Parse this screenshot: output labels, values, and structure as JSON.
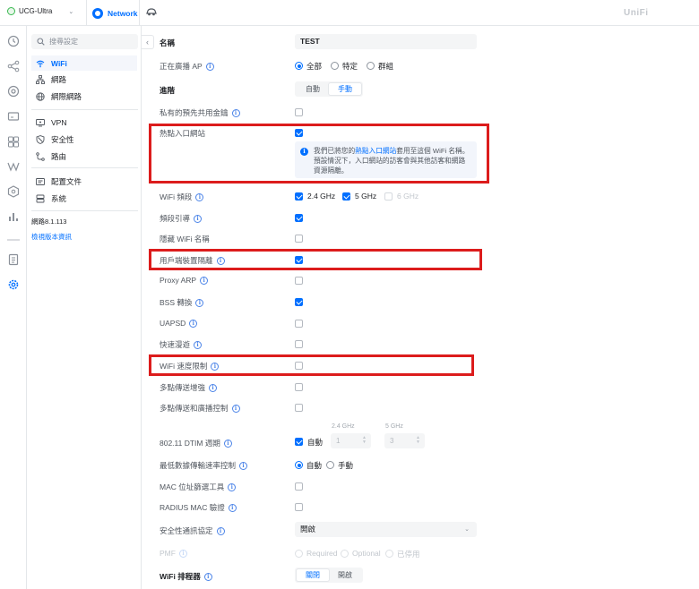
{
  "topbar": {
    "site_name": "UCG-Ultra",
    "app_tab": "Network",
    "brand": "UniFi"
  },
  "sidebar": {
    "search_placeholder": "搜尋設定",
    "items": [
      {
        "label": "WiFi",
        "icon": "wifi-icon"
      },
      {
        "label": "網路",
        "icon": "network-tree-icon"
      },
      {
        "label": "網際網路",
        "icon": "globe-icon"
      },
      {
        "label": "VPN",
        "icon": "vpn-icon"
      },
      {
        "label": "安全性",
        "icon": "shield-icon"
      },
      {
        "label": "路由",
        "icon": "route-icon"
      },
      {
        "label": "配置文件",
        "icon": "profile-icon"
      },
      {
        "label": "系統",
        "icon": "system-icon"
      }
    ],
    "version": "網路8.1.113",
    "release_notes": "檢視版本資訊"
  },
  "form": {
    "name": {
      "label": "名稱",
      "value": "TEST"
    },
    "broadcast_ap": {
      "label": "正在廣播 AP",
      "options": [
        "全部",
        "特定",
        "群組"
      ],
      "selected": 0
    },
    "advanced": {
      "label": "進階",
      "options": [
        "自動",
        "手動"
      ],
      "selected": 1
    },
    "private_psk": {
      "label": "私有的預先共用金鑰",
      "checked": false
    },
    "hotspot": {
      "label": "熱點入口網站",
      "checked": true
    },
    "notice": {
      "before": "我們已將您的",
      "link": "熱點入口網站",
      "after": "套用至這個 WiFi 名稱。預設情況下，入口網站的訪客會與其他訪客和網路資源隔離。"
    },
    "wifi_band": {
      "label": "WiFi 頻段",
      "bands": [
        {
          "name": "2.4 GHz",
          "checked": true,
          "disabled": false
        },
        {
          "name": "5 GHz",
          "checked": true,
          "disabled": false
        },
        {
          "name": "6 GHz",
          "checked": false,
          "disabled": true
        }
      ]
    },
    "band_steering": {
      "label": "頻段引導",
      "checked": true
    },
    "hide_ssid": {
      "label": "隱藏 WiFi 名稱",
      "checked": false
    },
    "client_isolation": {
      "label": "用戶端裝置隔離",
      "checked": true
    },
    "proxy_arp": {
      "label": "Proxy ARP",
      "checked": false
    },
    "bss_transition": {
      "label": "BSS 轉換",
      "checked": true
    },
    "uapsd": {
      "label": "UAPSD",
      "checked": false
    },
    "fast_roaming": {
      "label": "快速漫遊",
      "checked": false
    },
    "wifi_rate_limit": {
      "label": "WiFi 速度限制",
      "checked": false
    },
    "multicast_enhance": {
      "label": "多點傳送增強",
      "checked": false
    },
    "multicast_broadcast": {
      "label": "多點傳送和廣播控制",
      "checked": false
    },
    "dtim": {
      "label": "802.11 DTIM 週期",
      "auto_label": "自動",
      "auto_checked": true,
      "col_24": "2.4 GHz",
      "col_5": "5 GHz",
      "value_24": "1",
      "value_5": "3"
    },
    "min_rate": {
      "label": "最低數據傳輸速率控制",
      "options": [
        "自動",
        "手動"
      ],
      "selected": 0
    },
    "mac_filter": {
      "label": "MAC 位址篩選工具",
      "checked": false
    },
    "radius_mac": {
      "label": "RADIUS MAC 驗證",
      "checked": false
    },
    "security_protocol": {
      "label": "安全性通訊協定",
      "value": "開啟"
    },
    "pmf": {
      "label": "PMF",
      "options": [
        "Required",
        "Optional",
        "已停用"
      ]
    },
    "wifi_scheduler": {
      "label": "WiFi 排程器",
      "options": [
        "關閉",
        "開啟"
      ],
      "selected": 0
    }
  },
  "colors": {
    "accent": "#006fff",
    "highlight_box": "#dc1c1c"
  }
}
